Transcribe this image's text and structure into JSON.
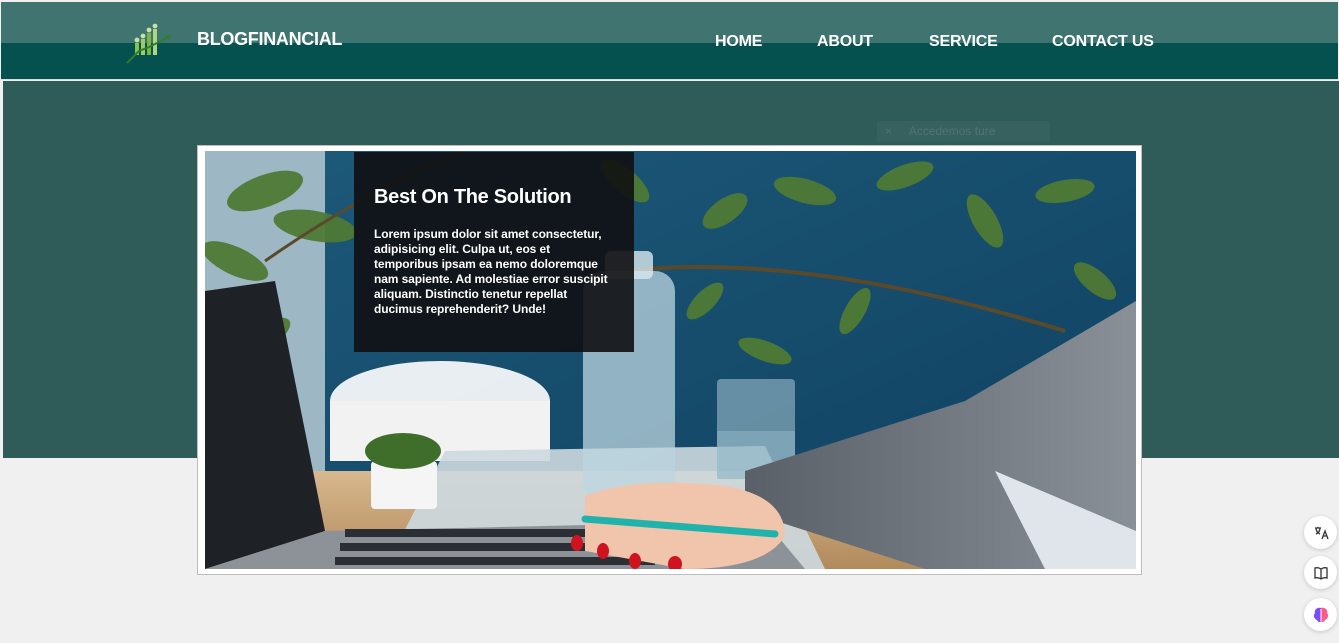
{
  "header": {
    "brand": "BLOGFINANCIAL",
    "nav": [
      "HOME",
      "ABOUT",
      "SERVICE",
      "CONTACT US"
    ]
  },
  "hero": {
    "title": "Best On The Solution",
    "body": "Lorem ipsum dolor sit amet consectetur, adipisicing elit. Culpa ut, eos et temporibus ipsam ea nemo doloremque nam sapiente. Ad molestiae error suscipit aliquam. Distinctio tenetur repellat ducimus reprehenderit? Unde!"
  },
  "ghost_chip": {
    "close": "×",
    "label": "Accedemos ture"
  },
  "side_tools": [
    {
      "icon": "translate-icon"
    },
    {
      "icon": "book-icon"
    },
    {
      "icon": "brain-icon"
    }
  ],
  "colors": {
    "header_top": "#3f7471",
    "header_bottom": "#045150",
    "hero_band": "#2f5b58",
    "page_bg": "#f0f0f0",
    "overlay": "#101012"
  }
}
